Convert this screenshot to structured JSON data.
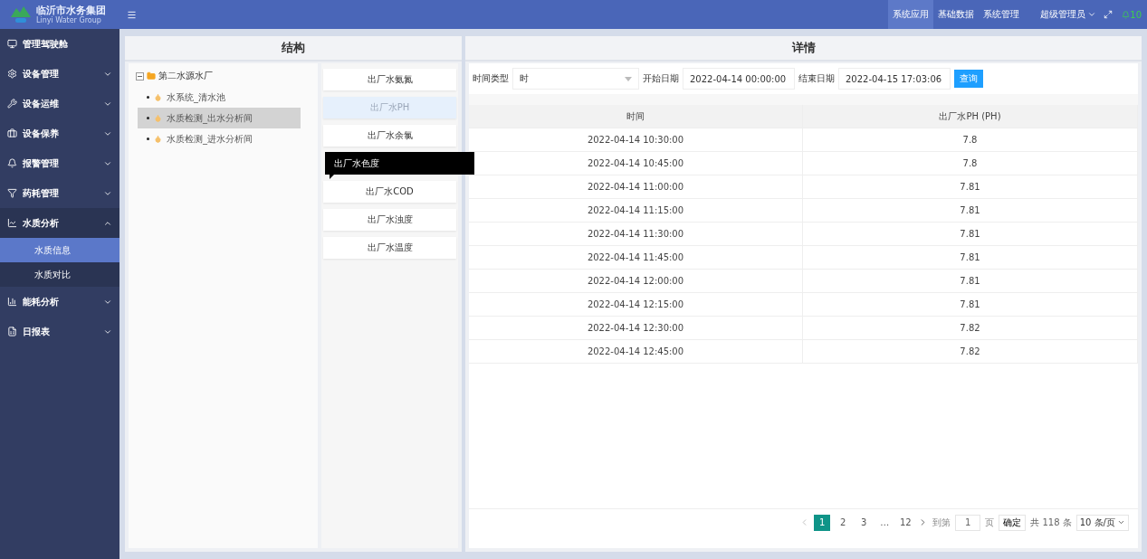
{
  "header": {
    "logo_title": "临沂市水务集团",
    "logo_subtitle": "Linyi Water Group",
    "nav": [
      {
        "label": "系统应用",
        "selected": true
      },
      {
        "label": "基础数据",
        "selected": false
      },
      {
        "label": "系统管理",
        "selected": false
      }
    ],
    "user": "超级管理员",
    "notifications": "10"
  },
  "sidebar": {
    "items": [
      {
        "label": "管理驾驶舱"
      },
      {
        "label": "设备管理",
        "expanded": false
      },
      {
        "label": "设备运维",
        "expanded": false
      },
      {
        "label": "设备保养",
        "expanded": false
      },
      {
        "label": "报警管理",
        "expanded": false
      },
      {
        "label": "药耗管理",
        "expanded": false
      },
      {
        "label": "水质分析",
        "expanded": true,
        "children": [
          {
            "label": "水质信息",
            "selected": true
          },
          {
            "label": "水质对比",
            "selected": false
          }
        ]
      },
      {
        "label": "能耗分析",
        "expanded": false
      },
      {
        "label": "日报表",
        "expanded": false
      }
    ]
  },
  "structure": {
    "title": "结构",
    "tree": [
      {
        "label": "第二水源水厂",
        "expanded": true,
        "children": [
          {
            "label": "水系统_清水池",
            "selected": false
          },
          {
            "label": "水质检测_出水分析间",
            "selected": true
          },
          {
            "label": "水质检测_进水分析间",
            "selected": false
          }
        ]
      }
    ],
    "metrics": [
      {
        "label": "出厂水氨氮",
        "selected": false
      },
      {
        "label": "出厂水PH",
        "selected": true
      },
      {
        "label": "出厂水余氯",
        "selected": false
      },
      {
        "label": "出厂水COD",
        "selected": false
      },
      {
        "label": "出厂水浊度",
        "selected": false
      },
      {
        "label": "出厂水温度",
        "selected": false
      }
    ],
    "tooltip": "出厂水色度"
  },
  "details": {
    "title": "详情",
    "filters": {
      "time_type_label": "时间类型",
      "time_type": "时",
      "start_label": "开始日期",
      "start": "2022-04-14 00:00:00",
      "end_label": "结束日期",
      "end": "2022-04-15 17:03:06",
      "query": "查询"
    },
    "table": {
      "columns": [
        "时间",
        "出厂水PH (PH)"
      ],
      "rows": [
        [
          "2022-04-14 10:30:00",
          "7.8"
        ],
        [
          "2022-04-14 10:45:00",
          "7.8"
        ],
        [
          "2022-04-14 11:00:00",
          "7.81"
        ],
        [
          "2022-04-14 11:15:00",
          "7.81"
        ],
        [
          "2022-04-14 11:30:00",
          "7.81"
        ],
        [
          "2022-04-14 11:45:00",
          "7.81"
        ],
        [
          "2022-04-14 12:00:00",
          "7.81"
        ],
        [
          "2022-04-14 12:15:00",
          "7.81"
        ],
        [
          "2022-04-14 12:30:00",
          "7.82"
        ],
        [
          "2022-04-14 12:45:00",
          "7.82"
        ]
      ]
    },
    "pagination": {
      "pages": [
        {
          "label": "1",
          "selected": true
        },
        {
          "label": "2",
          "selected": false
        },
        {
          "label": "3",
          "selected": false
        },
        {
          "label": "…",
          "selected": false
        },
        {
          "label": "12",
          "selected": false
        }
      ],
      "goto_label": "到第",
      "goto_value": "1",
      "page_unit": "页",
      "confirm": "确定",
      "total": "共 118 条",
      "page_size": "10 条/页"
    }
  }
}
